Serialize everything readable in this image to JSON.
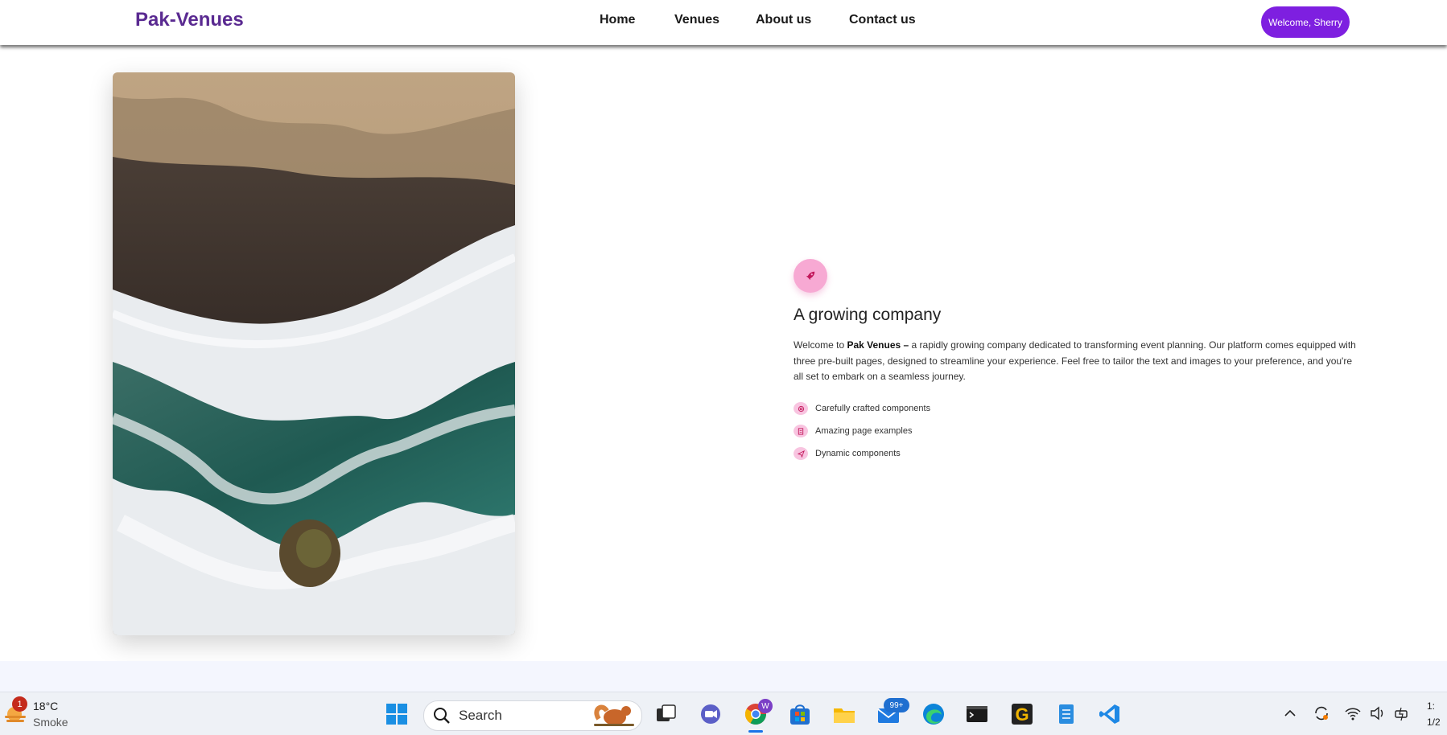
{
  "navbar": {
    "brand": "Pak-Venues",
    "links": [
      "Home",
      "Venues",
      "About us",
      "Contact us"
    ],
    "welcome_button": "Welcome, Sherry"
  },
  "hero": {
    "icon": "rocket-icon",
    "title": "A growing company",
    "desc_pre": "Welcome to ",
    "desc_bold": "Pak Venues – ",
    "desc_post": "a rapidly growing company dedicated to transforming event planning. Our platform comes equipped with three pre-built pages, designed to streamline your experience. Feel free to tailor the text and images to your preference, and you're all set to embark on a seamless journey.",
    "features": [
      {
        "icon": "fingerprint-icon",
        "label": "Carefully crafted components"
      },
      {
        "icon": "document-icon",
        "label": "Amazing page examples"
      },
      {
        "icon": "send-icon",
        "label": "Dynamic components"
      }
    ],
    "accent_color": "#7e1fe0",
    "pink_color": "#f7a9d3"
  },
  "taskbar": {
    "weather_temp": "18°C",
    "weather_condition": "Smoke",
    "weather_badge": "1",
    "search_placeholder": "Search",
    "chrome_badge": "W",
    "mail_badge": "99+",
    "clock_time": "1:",
    "clock_date": "1/2"
  }
}
